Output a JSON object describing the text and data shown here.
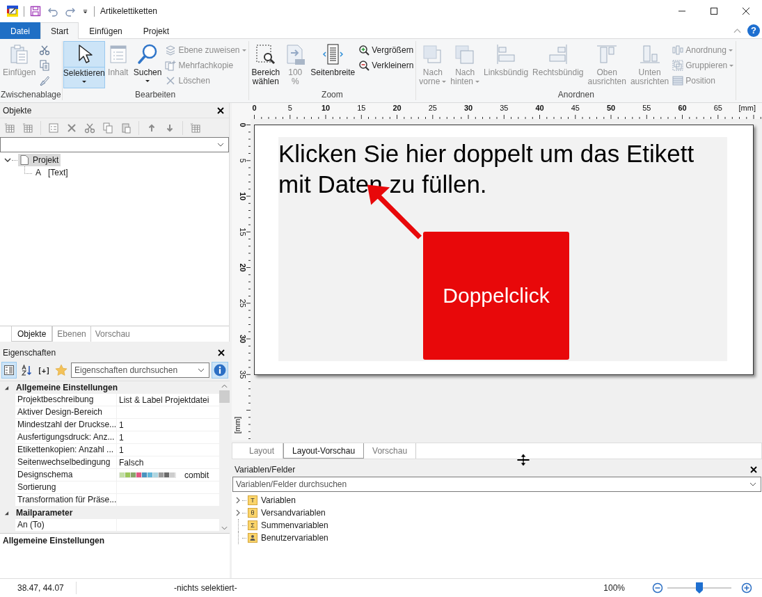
{
  "window": {
    "title": "Artikelettiketten"
  },
  "ribbon": {
    "help": "?",
    "tabs": [
      {
        "label": "Datei",
        "kind": "file",
        "selected": false
      },
      {
        "label": "Start",
        "kind": "tab",
        "selected": true
      },
      {
        "label": "Einfügen",
        "kind": "tab",
        "selected": false
      },
      {
        "label": "Projekt",
        "kind": "tab",
        "selected": false
      }
    ],
    "groups": [
      {
        "title": "Zwischenablage",
        "items": [
          {
            "kind": "large",
            "lines": [
              "Einfügen"
            ],
            "disabled": true,
            "on": false,
            "dropdown": false
          },
          {
            "kind": "stack",
            "items": [
              {
                "disabled": false,
                "dropdown": false
              },
              {
                "disabled": false,
                "dropdown": false
              },
              {
                "disabled": false,
                "dropdown": false
              }
            ]
          }
        ]
      },
      {
        "title": "Bearbeiten",
        "items": [
          {
            "kind": "large",
            "lines": [
              "Selektieren"
            ],
            "disabled": false,
            "on": true,
            "dropdown": true
          },
          {
            "kind": "large",
            "lines": [
              "Inhalt"
            ],
            "disabled": true,
            "on": false,
            "dropdown": false
          },
          {
            "kind": "large",
            "lines": [
              "Suchen"
            ],
            "disabled": false,
            "on": false,
            "dropdown": true
          },
          {
            "kind": "stack",
            "items": [
              {
                "label": "Ebene zuweisen",
                "disabled": true,
                "dropdown": true
              },
              {
                "label": "Mehrfachkopie",
                "disabled": true,
                "dropdown": false
              },
              {
                "label": "Löschen",
                "disabled": true,
                "dropdown": false
              }
            ]
          }
        ]
      },
      {
        "title": "Zoom",
        "items": [
          {
            "kind": "large",
            "lines": [
              "Bereich",
              "wählen"
            ],
            "disabled": false,
            "on": false,
            "dropdown": false
          },
          {
            "kind": "large",
            "lines": [
              "100",
              "%"
            ],
            "disabled": true,
            "on": false,
            "dropdown": false
          },
          {
            "kind": "large",
            "lines": [
              "Seitenbreite"
            ],
            "disabled": false,
            "on": false,
            "dropdown": false
          },
          {
            "kind": "stack",
            "items": [
              {
                "label": "Vergrößern",
                "disabled": false,
                "dropdown": false
              },
              {
                "label": "Verkleinern",
                "disabled": false,
                "dropdown": false
              }
            ]
          }
        ]
      },
      {
        "title": "Anordnen",
        "items": [
          {
            "kind": "large",
            "lines": [
              "Nach",
              "vorne"
            ],
            "disabled": true,
            "on": false,
            "dropdown": true
          },
          {
            "kind": "large",
            "lines": [
              "Nach",
              "hinten"
            ],
            "disabled": true,
            "on": false,
            "dropdown": true
          },
          {
            "kind": "large",
            "lines": [
              "Linksbündig"
            ],
            "disabled": true,
            "on": false,
            "dropdown": false
          },
          {
            "kind": "large",
            "lines": [
              "Rechtsbündig"
            ],
            "disabled": true,
            "on": false,
            "dropdown": false
          },
          {
            "kind": "large",
            "lines": [
              "Oben",
              "ausrichten"
            ],
            "disabled": true,
            "on": false,
            "dropdown": false
          },
          {
            "kind": "large",
            "lines": [
              "Unten",
              "ausrichten"
            ],
            "disabled": true,
            "on": false,
            "dropdown": false
          },
          {
            "kind": "stack",
            "items": [
              {
                "label": "Anordnung",
                "disabled": true,
                "dropdown": true
              },
              {
                "label": "Gruppieren",
                "disabled": true,
                "dropdown": true
              },
              {
                "label": "Position",
                "disabled": true,
                "dropdown": false
              }
            ]
          }
        ]
      }
    ]
  },
  "objects_panel": {
    "title": "Objekte",
    "tree": [
      {
        "label": "Projekt",
        "selected": true,
        "expanded": true,
        "children": [
          {
            "label": "[Text]",
            "glyph": "A",
            "selected": false
          }
        ]
      }
    ],
    "tabs": [
      {
        "label": "Objekte",
        "selected": true
      },
      {
        "label": "Ebenen",
        "selected": false
      },
      {
        "label": "Vorschau",
        "selected": false
      }
    ]
  },
  "properties": {
    "title": "Eigenschaften",
    "toolbar": [
      {
        "kind": "categorized",
        "selected": true
      },
      {
        "kind": "alphabetical",
        "selected": false
      },
      {
        "kind": "expand",
        "label": "[+]",
        "selected": false
      },
      {
        "kind": "favorites",
        "selected": false
      }
    ],
    "search": {
      "placeholder": "Eigenschaften durchsuchen"
    },
    "info": {
      "selected": true
    },
    "categories": [
      {
        "title": "Allgemeine Einstellungen",
        "expanded": true,
        "rows": [
          {
            "name": "Projektbeschreibung",
            "kind": "text",
            "value": "List & Label Projektdatei"
          },
          {
            "name": "Aktiver Design-Bereich",
            "kind": "text"
          },
          {
            "name": "Mindestzahl der Druckse...",
            "kind": "text",
            "value": "1"
          },
          {
            "name": "Ausfertigungsdruck: Anz...",
            "kind": "text",
            "value": "1"
          },
          {
            "name": "Etikettenkopien: Anzahl ...",
            "kind": "text",
            "value": "1"
          },
          {
            "name": "Seitenwechselbedingung",
            "kind": "text",
            "value": "Falsch"
          },
          {
            "name": "Designschema",
            "kind": "scheme",
            "value": "combit",
            "swatches": [
              {
                "color": "#c3dea6"
              },
              {
                "color": "#9dc75b"
              },
              {
                "color": "#8aa56a"
              },
              {
                "color": "#e25781"
              },
              {
                "color": "#4a93bf"
              },
              {
                "color": "#62b6d9"
              },
              {
                "color": "#aed6e1"
              },
              {
                "color": "#9a9a9a"
              },
              {
                "color": "#6b6b6b"
              },
              {
                "color": "#cdcdcd"
              }
            ]
          },
          {
            "name": "Sortierung",
            "kind": "text"
          },
          {
            "name": "Transformation für Präse...",
            "kind": "text"
          }
        ]
      },
      {
        "title": "Mailparameter",
        "expanded": true,
        "rows": [
          {
            "name": "An (To)",
            "kind": "text"
          }
        ]
      }
    ],
    "description": "Allgemeine Einstellungen"
  },
  "designer": {
    "ruler": {
      "x_labels": [
        "0",
        "5",
        "10",
        "15",
        "20",
        "25",
        "30",
        "35",
        "40",
        "45",
        "50",
        "55",
        "60",
        "65"
      ],
      "x_unit": "[mm]",
      "y_labels": [
        "0",
        "5",
        "10",
        "15",
        "20",
        "25",
        "30",
        "35"
      ],
      "y_unit": "[mm]"
    },
    "label_text": "Klicken Sie hier doppelt um das Etikett mit Daten zu füllen.",
    "callout": "Doppelclick",
    "tabs": [
      {
        "label": "Layout",
        "selected": false
      },
      {
        "label": "Layout-Vorschau",
        "selected": true
      },
      {
        "label": "Vorschau",
        "selected": false
      }
    ]
  },
  "variables": {
    "title": "Variablen/Felder",
    "search": {
      "placeholder": "Variablen/Felder durchsuchen"
    },
    "items": [
      {
        "label": "Variablen",
        "glyph": "T",
        "expandable": true
      },
      {
        "label": "Versandvariablen",
        "glyph": "θ",
        "expandable": true
      },
      {
        "label": "Summenvariablen",
        "glyph": "Σ",
        "expandable": false
      },
      {
        "label": "Benutzervariablen",
        "expandable": false
      }
    ]
  },
  "status_bar": {
    "coordinates": "38.47, 44.07",
    "selection": "-nichts selektiert-",
    "zoom": "100%",
    "zoom_slider": {
      "level": 0.5
    }
  }
}
